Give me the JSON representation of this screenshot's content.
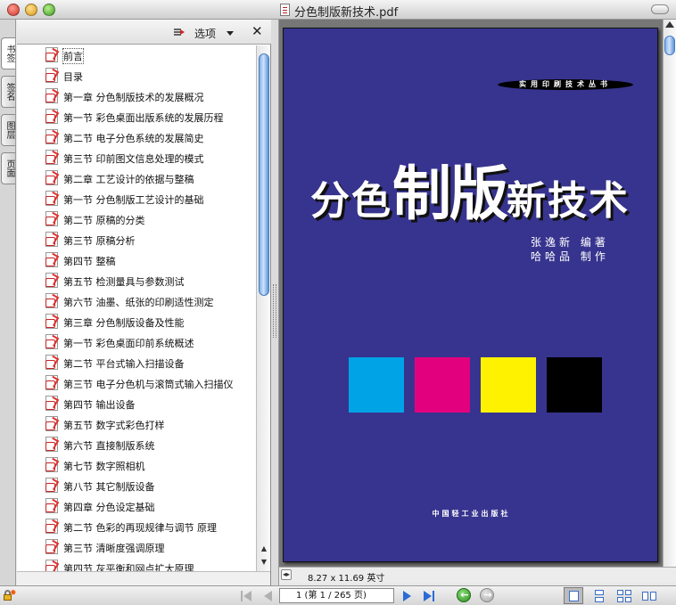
{
  "window": {
    "title": "分色制版新技术.pdf"
  },
  "side_tabs": [
    "书签",
    "签名",
    "图层",
    "页面"
  ],
  "nav_pane": {
    "options_label": "选项",
    "close_glyph": "✕",
    "bookmarks": [
      "前言",
      "目录",
      "第一章  分色制版技术的发展概况",
      "第一节  彩色桌面出版系统的发展历程",
      "第二节  电子分色系统的发展简史",
      "第三节  印前图文信息处理的模式",
      "第二章  工艺设计的依据与整稿",
      "第一节  分色制版工艺设计的基础",
      "第二节  原稿的分类",
      "第三节  原稿分析",
      "第四节  整稿",
      "第五节  检测量具与参数测试",
      "第六节  油墨、纸张的印刷适性测定",
      "第三章  分色制版设备及性能",
      "第一节  彩色桌面印前系统概述",
      "第二节  平台式输入扫描设备",
      "第三节  电子分色机与滚筒式输入扫描仪",
      "第四节  输出设备",
      "第五节  数字式彩色打样",
      "第六节  直接制版系统",
      "第七节  数字照相机",
      "第八节  其它制版设备",
      "第四章  分色设定基础",
      "第二节  色彩的再现规律与调节  原理",
      "第三节  清晰度强调原理",
      "第四节  灰平衡和网点扩大原理"
    ]
  },
  "cover": {
    "series": "实用印刷技术丛书",
    "title_parts": [
      "分色",
      "制版",
      "新技术"
    ],
    "author_line_1": "张逸新    编著",
    "author_line_2": "哈哈品    制作",
    "publisher": "中国轻工业出版社",
    "swatch_colors": [
      "#00a3e6",
      "#e3007f",
      "#fff200",
      "#000000"
    ],
    "background_color": "#37348f"
  },
  "status": {
    "page_size": "8.27 x 11.69 英寸",
    "page_field": "1 (第 1 / 265 页)"
  },
  "icons": {
    "lock": "lock-icon",
    "first_page": "first-page-icon",
    "previous_page": "previous-page-icon",
    "next_page": "next-page-icon",
    "last_page": "last-page-icon",
    "go_back": "go-back-icon",
    "go_forward": "go-forward-icon"
  },
  "accent_color": "#2a6bd6"
}
